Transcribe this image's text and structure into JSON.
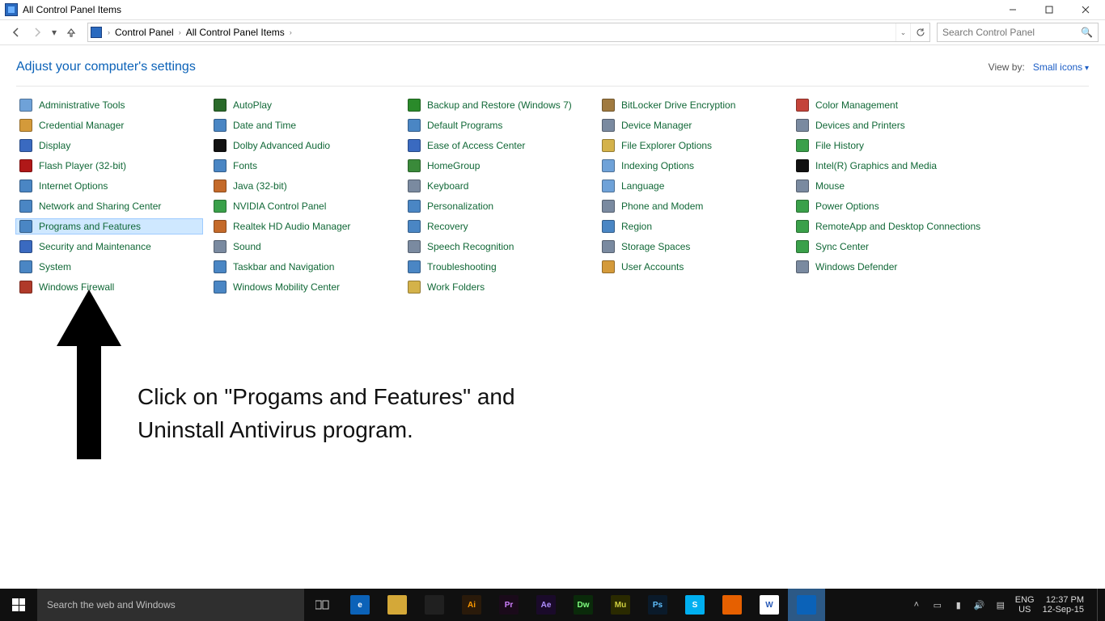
{
  "window": {
    "title": "All Control Panel Items"
  },
  "breadcrumb": {
    "root": "Control Panel",
    "current": "All Control Panel Items"
  },
  "search": {
    "placeholder": "Search Control Panel"
  },
  "heading": "Adjust your computer's settings",
  "viewby": {
    "label": "View by:",
    "value": "Small icons"
  },
  "items": [
    {
      "label": "Administrative Tools",
      "c": "#6fa2d8"
    },
    {
      "label": "AutoPlay",
      "c": "#2a6a2a"
    },
    {
      "label": "Backup and Restore (Windows 7)",
      "c": "#2a8a2a"
    },
    {
      "label": "BitLocker Drive Encryption",
      "c": "#a07a40"
    },
    {
      "label": "Color Management",
      "c": "#c4443a"
    },
    {
      "label": "Credential Manager",
      "c": "#d49a3a"
    },
    {
      "label": "Date and Time",
      "c": "#4a86c4"
    },
    {
      "label": "Default Programs",
      "c": "#4a86c4"
    },
    {
      "label": "Device Manager",
      "c": "#7a8aa0"
    },
    {
      "label": "Devices and Printers",
      "c": "#7a8aa0"
    },
    {
      "label": "Display",
      "c": "#3a6ac0"
    },
    {
      "label": "Dolby Advanced Audio",
      "c": "#111111"
    },
    {
      "label": "Ease of Access Center",
      "c": "#3a6ac0"
    },
    {
      "label": "File Explorer Options",
      "c": "#d4b24a"
    },
    {
      "label": "File History",
      "c": "#3aa04a"
    },
    {
      "label": "Flash Player (32-bit)",
      "c": "#b01818"
    },
    {
      "label": "Fonts",
      "c": "#4a86c4"
    },
    {
      "label": "HomeGroup",
      "c": "#3a8a3a"
    },
    {
      "label": "Indexing Options",
      "c": "#6fa2d8"
    },
    {
      "label": "Intel(R) Graphics and Media",
      "c": "#111111"
    },
    {
      "label": "Internet Options",
      "c": "#4a86c4"
    },
    {
      "label": "Java (32-bit)",
      "c": "#c46a2a"
    },
    {
      "label": "Keyboard",
      "c": "#7a8aa0"
    },
    {
      "label": "Language",
      "c": "#6fa2d8"
    },
    {
      "label": "Mouse",
      "c": "#7a8aa0"
    },
    {
      "label": "Network and Sharing Center",
      "c": "#4a86c4"
    },
    {
      "label": "NVIDIA Control Panel",
      "c": "#3aa04a"
    },
    {
      "label": "Personalization",
      "c": "#4a86c4"
    },
    {
      "label": "Phone and Modem",
      "c": "#7a8aa0"
    },
    {
      "label": "Power Options",
      "c": "#3aa04a"
    },
    {
      "label": "Programs and Features",
      "c": "#4a86c4",
      "selected": true
    },
    {
      "label": "Realtek HD Audio Manager",
      "c": "#c46a2a"
    },
    {
      "label": "Recovery",
      "c": "#4a86c4"
    },
    {
      "label": "Region",
      "c": "#4a86c4"
    },
    {
      "label": "RemoteApp and Desktop Connections",
      "c": "#3aa04a"
    },
    {
      "label": "Security and Maintenance",
      "c": "#3a6ac0"
    },
    {
      "label": "Sound",
      "c": "#7a8aa0"
    },
    {
      "label": "Speech Recognition",
      "c": "#7a8aa0"
    },
    {
      "label": "Storage Spaces",
      "c": "#7a8aa0"
    },
    {
      "label": "Sync Center",
      "c": "#3aa04a"
    },
    {
      "label": "System",
      "c": "#4a86c4"
    },
    {
      "label": "Taskbar and Navigation",
      "c": "#4a86c4"
    },
    {
      "label": "Troubleshooting",
      "c": "#4a86c4"
    },
    {
      "label": "User Accounts",
      "c": "#d49a3a"
    },
    {
      "label": "Windows Defender",
      "c": "#7a8aa0"
    },
    {
      "label": "Windows Firewall",
      "c": "#b03a2a"
    },
    {
      "label": "Windows Mobility Center",
      "c": "#4a86c4"
    },
    {
      "label": "Work Folders",
      "c": "#d4b24a"
    }
  ],
  "annotation": {
    "line1": "Click on \"Progams and Features\" and",
    "line2": "Uninstall Antivirus program."
  },
  "taskbar": {
    "search_placeholder": "Search the web and Windows",
    "apps": [
      {
        "name": "taskview",
        "bg": "transparent",
        "label": ""
      },
      {
        "name": "edge",
        "bg": "#0b62b8",
        "label": "e"
      },
      {
        "name": "file-explorer",
        "bg": "#d4a838",
        "label": ""
      },
      {
        "name": "store",
        "bg": "#202020",
        "label": ""
      },
      {
        "name": "ai",
        "bg": "#2a1a0a",
        "label": "Ai",
        "fg": "#ff9a00"
      },
      {
        "name": "pr",
        "bg": "#1a0a1a",
        "label": "Pr",
        "fg": "#d080ff"
      },
      {
        "name": "ae",
        "bg": "#1a0a2a",
        "label": "Ae",
        "fg": "#b090ff"
      },
      {
        "name": "dw",
        "bg": "#0a2a0a",
        "label": "Dw",
        "fg": "#80ff80"
      },
      {
        "name": "mu",
        "bg": "#2a2a00",
        "label": "Mu",
        "fg": "#d0d040"
      },
      {
        "name": "ps",
        "bg": "#0a1a2a",
        "label": "Ps",
        "fg": "#60c0ff"
      },
      {
        "name": "skype",
        "bg": "#00aff0",
        "label": "S"
      },
      {
        "name": "firefox",
        "bg": "#e66000",
        "label": ""
      },
      {
        "name": "word",
        "bg": "#ffffff",
        "label": "W",
        "fg": "#2a5bb8"
      },
      {
        "name": "controlpanel",
        "bg": "#0b62b8",
        "label": "",
        "active": true
      }
    ],
    "lang_top": "ENG",
    "lang_bottom": "US",
    "time": "12:37 PM",
    "date": "12-Sep-15"
  }
}
